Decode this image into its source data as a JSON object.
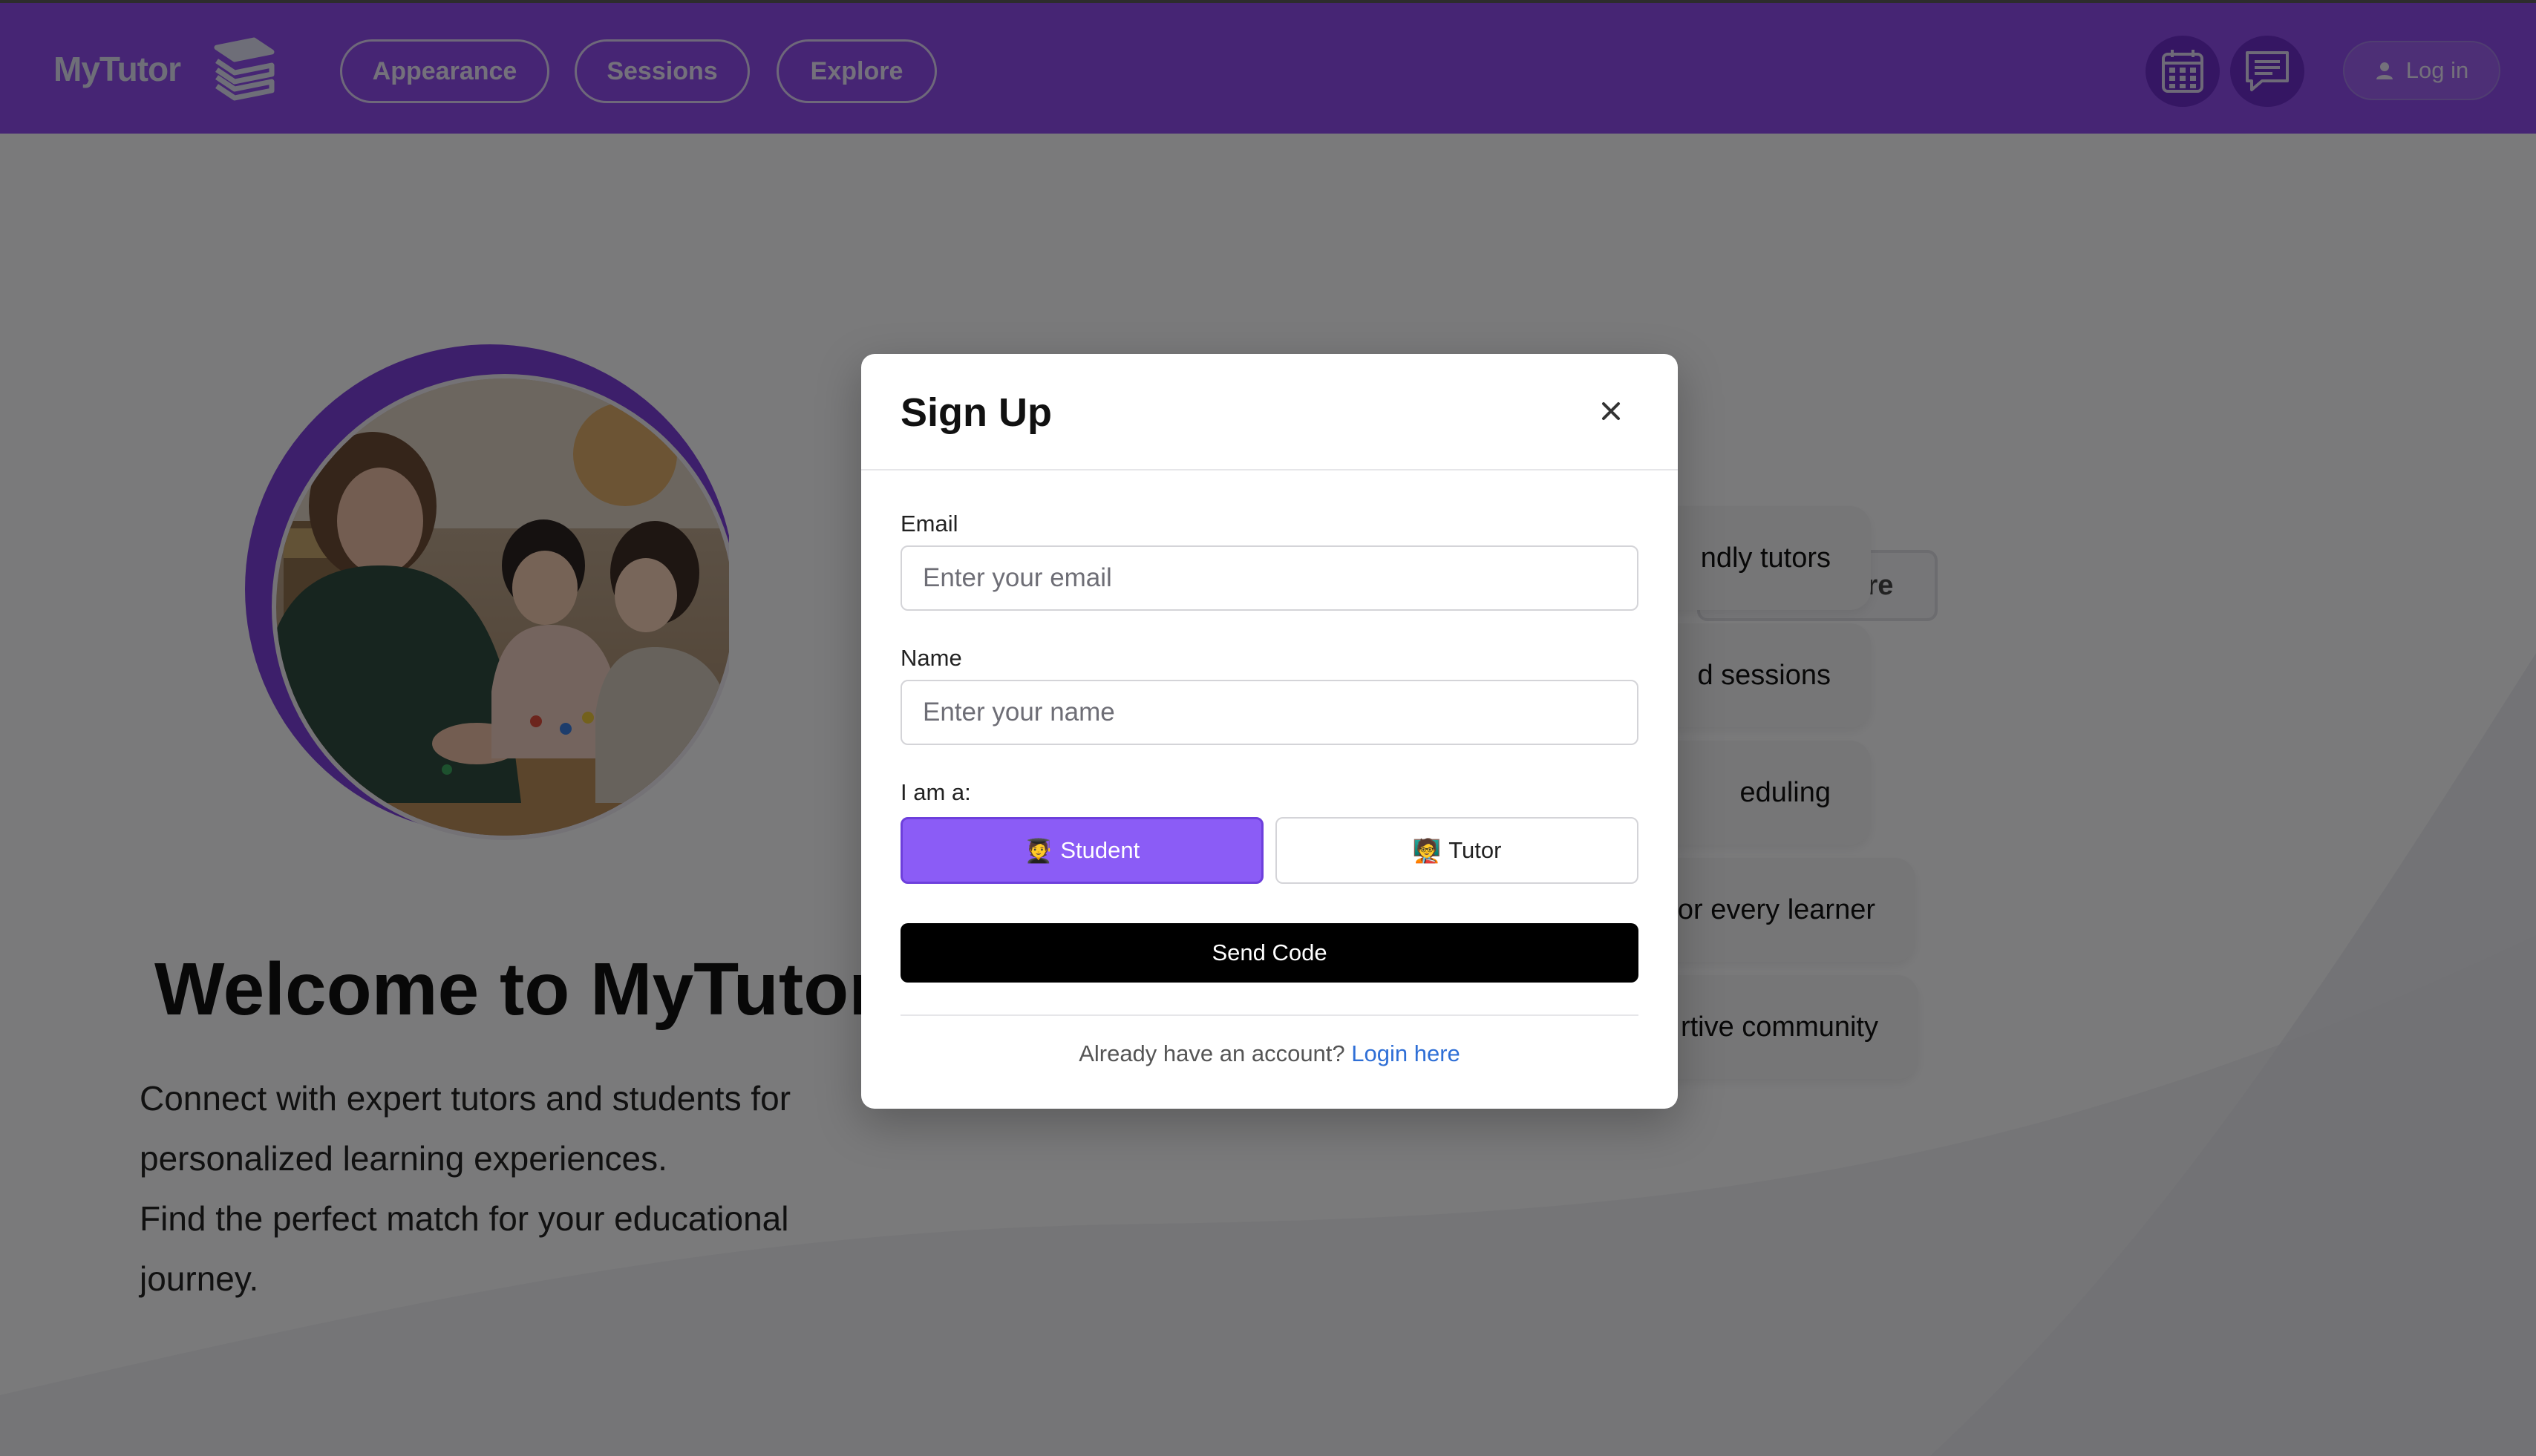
{
  "nav": {
    "logo_text": "MyTutor",
    "items": [
      {
        "label": "Appearance"
      },
      {
        "label": "Sessions"
      },
      {
        "label": "Explore"
      }
    ],
    "login_label": "Log in",
    "icons": [
      "calendar-icon",
      "chat-icon",
      "user-icon"
    ]
  },
  "hero": {
    "title": "Welcome to MyTutor",
    "desc_line1": "Connect with expert tutors and students for personalized learning experiences.",
    "desc_line2": "Find the perfect match for your educational journey."
  },
  "side": {
    "learn_more": "Learn More",
    "features": [
      "ndly tutors",
      "d sessions",
      "eduling",
      "or every learner",
      "rtive community"
    ]
  },
  "modal": {
    "title": "Sign Up",
    "email_label": "Email",
    "email_placeholder": "Enter your email",
    "name_label": "Name",
    "name_placeholder": "Enter your name",
    "role_label": "I am a:",
    "student_label": "Student",
    "student_emoji": "🧑‍🎓",
    "tutor_label": "Tutor",
    "tutor_emoji": "🧑‍🏫",
    "send_label": "Send Code",
    "footer_text": "Already have an account?",
    "footer_link": "Login here"
  },
  "colors": {
    "nav_bg": "#8c4be9",
    "accent": "#8b5cf6",
    "link": "#2f6fd6"
  }
}
